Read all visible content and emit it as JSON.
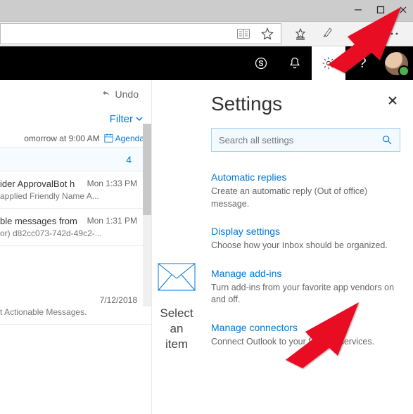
{
  "window": {
    "minimize": "—",
    "maximize": "☐",
    "close": "✕"
  },
  "appbar": {
    "skype_icon": "skype-icon",
    "bell_icon": "bell-icon",
    "gear_icon": "gear-icon",
    "help": "?"
  },
  "undo": {
    "label": "Undo"
  },
  "filter": {
    "label": "Filter"
  },
  "agenda": {
    "text": "omorrow at 9:00 AM",
    "link": "Agenda"
  },
  "pinned_count": "4",
  "messages": [
    {
      "subject": "ider ApprovalBot h",
      "time": "Mon 1:33 PM",
      "preview": "applied Friendly Name A..."
    },
    {
      "subject": "ble messages from",
      "time": "Mon 1:31 PM",
      "preview": "or) d82cc073-742d-49c2-..."
    },
    {
      "subject": "",
      "time": "7/12/2018",
      "preview": "t Actionable Messages."
    }
  ],
  "reading_pane": {
    "w1": "Select",
    "w2": "an",
    "w3": "item"
  },
  "settings": {
    "title": "Settings",
    "search_placeholder": "Search all settings",
    "options": [
      {
        "title": "Automatic replies",
        "desc": "Create an automatic reply (Out of office) message."
      },
      {
        "title": "Display settings",
        "desc": "Choose how your Inbox should be organized."
      },
      {
        "title": "Manage add-ins",
        "desc": "Turn add-ins from your favorite app vendors on and off."
      },
      {
        "title": "Manage connectors",
        "desc": "Connect Outlook to your favorite services."
      }
    ]
  }
}
